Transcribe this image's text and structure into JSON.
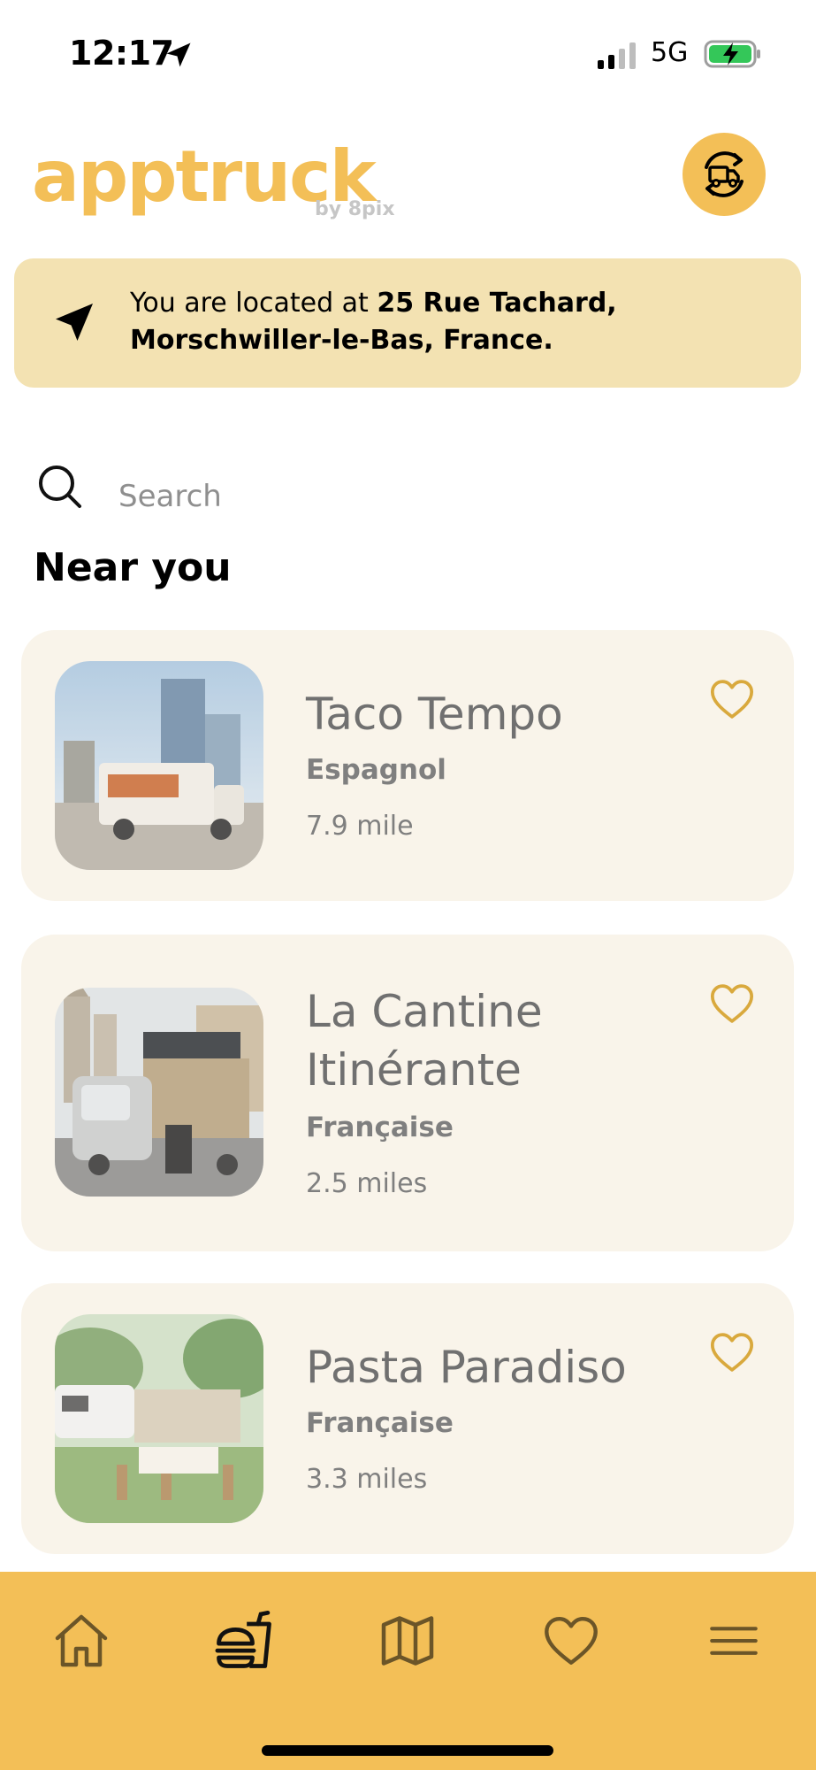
{
  "status_bar": {
    "time": "12:17",
    "network": "5G"
  },
  "header": {
    "logo": "apptruck",
    "logo_sub": "by 8pix",
    "switch_icon": "truck-refresh-icon"
  },
  "location": {
    "prefix": "You are located at ",
    "address": "25 Rue Tachard, Morschwiller-le-Bas, France."
  },
  "search": {
    "placeholder": "Search"
  },
  "section_title": "Near you",
  "trucks": [
    {
      "name": "Taco Tempo",
      "cuisine": "Espagnol",
      "distance": "7.9 mile"
    },
    {
      "name": "La Cantine Itinérante",
      "cuisine": "Française",
      "distance": "2.5 miles"
    },
    {
      "name": "Pasta Paradiso",
      "cuisine": "Française",
      "distance": "3.3 miles"
    }
  ],
  "bottom_nav": [
    "home-icon",
    "food-icon",
    "map-icon",
    "heart-icon",
    "menu-icon"
  ],
  "colors": {
    "accent": "#f3bf57",
    "banner": "#f3e2b2",
    "card": "#f9f4ea",
    "heart": "#d9a93d"
  }
}
